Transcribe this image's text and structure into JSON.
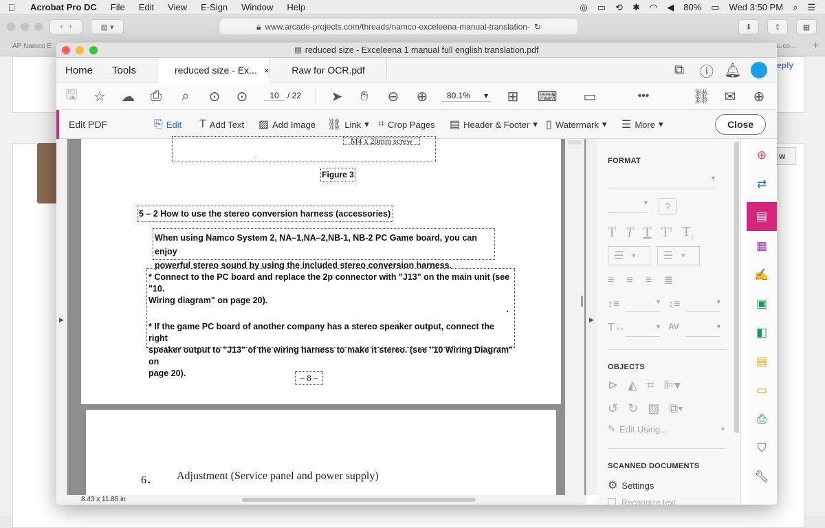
{
  "menubar": {
    "app": "Acrobat Pro DC",
    "items": [
      "File",
      "Edit",
      "View",
      "E-Sign",
      "Window",
      "Help"
    ],
    "battery": "80%",
    "clock": "Wed 3:50 PM"
  },
  "safari": {
    "url": "www.arcade-projects.com/threads/namco-exceleena-manual-translation-",
    "bg_tab_left": "Namco E",
    "bg_tab_right": "u.co...",
    "bg_reply": "eply",
    "bg_w": "w"
  },
  "window": {
    "title": "reduced size - Exceleena 1 manual full english translation.pdf"
  },
  "tabs": {
    "home": "Home",
    "tools": "Tools",
    "doc1": "reduced size - Ex...",
    "doc1_close": "×",
    "doc2": "Raw for OCR.pdf"
  },
  "toolbar": {
    "page_current": "10",
    "page_total": "/ 22",
    "zoom": "80.1%"
  },
  "editbar": {
    "title": "Edit PDF",
    "edit": "Edit",
    "add_text": "Add Text",
    "add_image": "Add Image",
    "link": "Link",
    "crop": "Crop Pages",
    "header_footer": "Header & Footer",
    "watermark": "Watermark",
    "more": "More",
    "close": "Close"
  },
  "document": {
    "screw_label": "M4 x 20mm screw",
    "figure": "Figure 3",
    "section_heading": "5 – 2  How to use the stereo conversion harness (accessories)",
    "intro_line1": "When using Namco System 2, NA–1,NA–2,NB-1, NB-2  PC Game board, you can enjoy",
    "intro_line2": "powerful stereo sound by using the included stereo conversion harness.",
    "bullet1_line1": "* Connect to the PC board and replace the 2p connector with \"J13\" on the main unit (see \"10.",
    "bullet1_line2": "Wiring diagram\" on page 20).",
    "bullet2_line1": "* If the game PC board of another company has a stereo speaker output, connect the right",
    "bullet2_line2": "speaker output to \"J13\" of the wiring harness to make it stereo. (see \"10 Wiring Diagram\" on",
    "bullet2_line3": "page 20).",
    "page_number": "– 8 –",
    "next_heading_num": "6．",
    "next_heading": "Adjustment (Service panel and power supply)"
  },
  "status": {
    "page_size": "8.43 x 11.85 in"
  },
  "format_panel": {
    "format_heading": "FORMAT",
    "objects_heading": "OBJECTS",
    "edit_using": "Edit Using...",
    "scanned_heading": "SCANNED DOCUMENTS",
    "settings": "Settings",
    "recognize": "Recognize text"
  },
  "colors": {
    "accent": "#d6257d",
    "link_blue": "#1473e6"
  }
}
